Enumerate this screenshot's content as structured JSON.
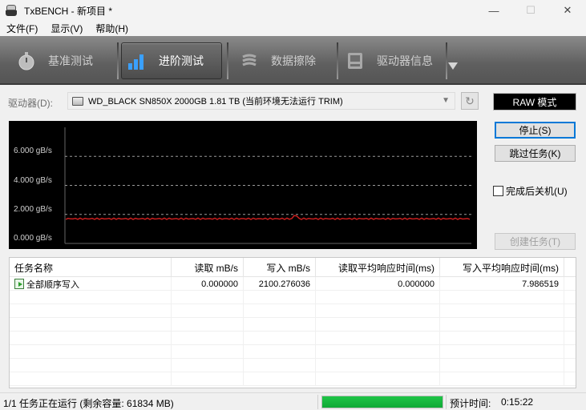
{
  "window": {
    "title": "TxBENCH - 新项目 *",
    "minimize": "—",
    "maximize": "☐",
    "close": "✕"
  },
  "menu": [
    {
      "label": "文件(F)"
    },
    {
      "label": "显示(V)"
    },
    {
      "label": "帮助(H)"
    }
  ],
  "toolbar": {
    "tabs": [
      {
        "label": "基准测试",
        "icon": "stopwatch-icon",
        "active": false
      },
      {
        "label": "进阶测试",
        "icon": "bar-chart-icon",
        "active": true
      },
      {
        "label": "数据擦除",
        "icon": "eraser-icon",
        "active": false
      },
      {
        "label": "驱动器信息",
        "icon": "drive-info-icon",
        "active": false
      }
    ]
  },
  "drive": {
    "label": "驱动器(D):",
    "selected": "WD_BLACK SN850X 2000GB  1.81 TB (当前环境无法运行 TRIM)",
    "mode_badge": "RAW 模式"
  },
  "graph": {
    "y_ticks": [
      "6.000 gB/s",
      "4.000 gB/s",
      "2.000 gB/s",
      "0.000 gB/s"
    ],
    "y_tick_values": [
      6,
      4,
      2,
      0
    ],
    "y_max": 8,
    "line_color": "#c81e1e",
    "series_value": 1.7
  },
  "controls": {
    "stop": "停止(S)",
    "skip": "跳过任务(K)",
    "shutdown": "完成后关机(U)",
    "shutdown_checked": false,
    "create": "创建任务(T)"
  },
  "tasks": {
    "columns": [
      "任务名称",
      "读取 mB/s",
      "写入 mB/s",
      "读取平均响应时间(ms)",
      "写入平均响应时间(ms)"
    ],
    "rows": [
      {
        "name": "全部顺序写入",
        "read": "0.000000",
        "write": "2100.276036",
        "read_avg": "0.000000",
        "write_avg": "7.986519"
      }
    ]
  },
  "status": {
    "text": "1/1 任务正在运行 (剩余容量: 61834 MB)",
    "progress": 1.0,
    "eta_label": "预计时间:",
    "eta_value": "0:15:22"
  }
}
